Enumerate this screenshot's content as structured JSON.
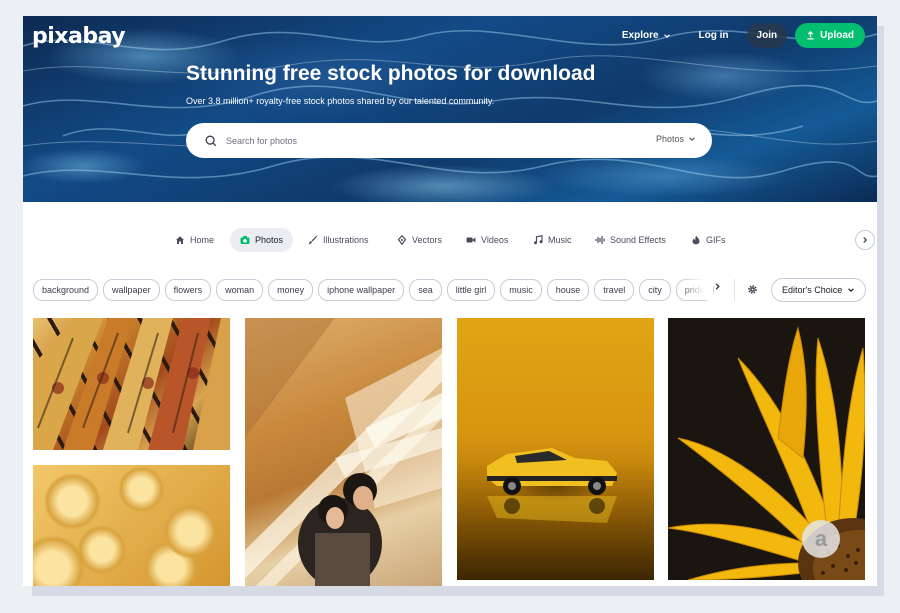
{
  "header": {
    "logo": "pixabay",
    "nav": {
      "explore": "Explore",
      "login": "Log in",
      "join": "Join",
      "upload": "Upload"
    }
  },
  "hero": {
    "title": "Stunning free stock photos for download",
    "subtitle": "Over 3.8 million+ royalty-free stock photos shared by our talented community.",
    "search_placeholder": "Search for photos",
    "search_type": "Photos"
  },
  "categories": [
    {
      "label": "Home",
      "icon": "home-icon"
    },
    {
      "label": "Photos",
      "icon": "camera-icon",
      "active": true
    },
    {
      "label": "Illustrations",
      "icon": "brush-icon"
    },
    {
      "label": "Vectors",
      "icon": "pen-nib-icon"
    },
    {
      "label": "Videos",
      "icon": "video-camera-icon"
    },
    {
      "label": "Music",
      "icon": "music-note-icon"
    },
    {
      "label": "Sound Effects",
      "icon": "waveform-icon"
    },
    {
      "label": "GIFs",
      "icon": "gif-flame-icon"
    }
  ],
  "tags": [
    "background",
    "wallpaper",
    "flowers",
    "woman",
    "money",
    "iphone wallpaper",
    "sea",
    "little girl",
    "music",
    "house",
    "travel",
    "city",
    "pride"
  ],
  "filter": {
    "sort_label": "Editor's Choice"
  },
  "photos": [
    {
      "subject": "books"
    },
    {
      "subject": "pasta"
    },
    {
      "subject": "couple-embrace"
    },
    {
      "subject": "toy-car"
    },
    {
      "subject": "sunflower"
    }
  ],
  "colors": {
    "upload_green": "#02be6e",
    "join_bg": "#28374b",
    "active_tab_bg": "#ebedf3"
  }
}
